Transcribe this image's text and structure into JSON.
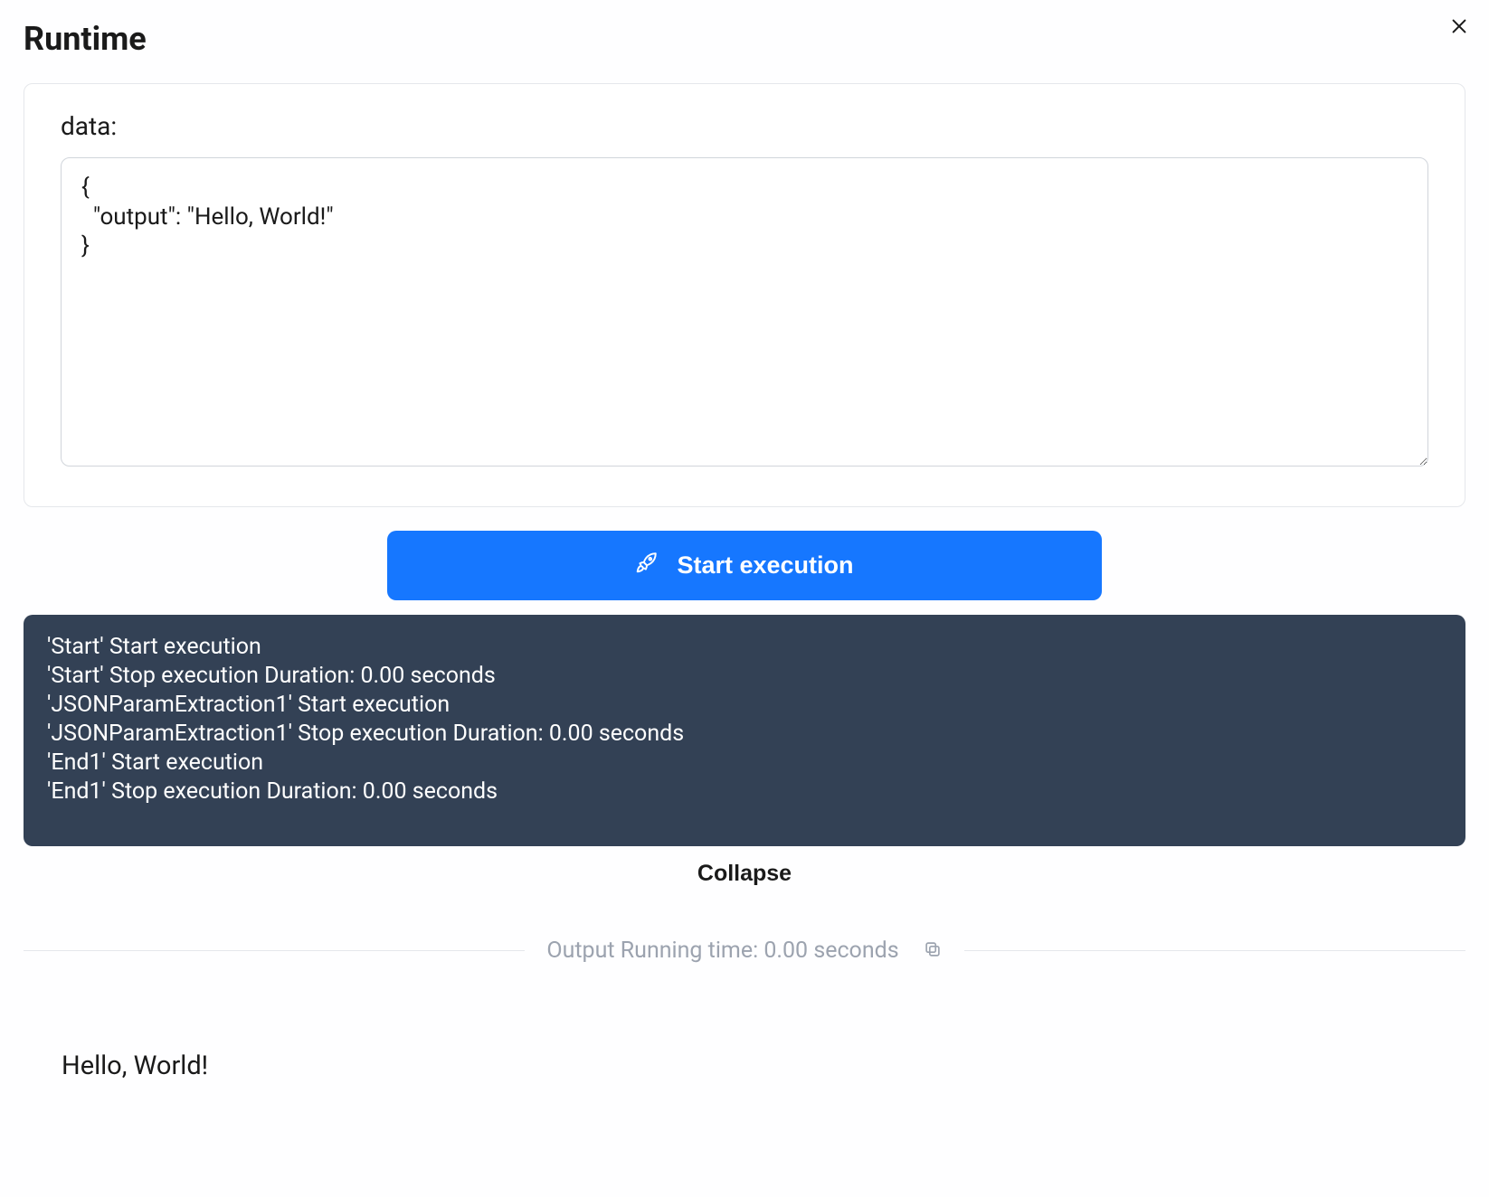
{
  "header": {
    "title": "Runtime"
  },
  "input": {
    "label": "data:",
    "value": "{\n  \"output\": \"Hello, World!\"\n}"
  },
  "actions": {
    "start_label": "Start execution",
    "collapse_label": "Collapse"
  },
  "log": {
    "lines": [
      "'Start' Start execution",
      "'Start' Stop execution Duration: 0.00 seconds",
      "'JSONParamExtraction1' Start execution",
      "'JSONParamExtraction1' Stop execution Duration: 0.00 seconds",
      "'End1' Start execution",
      "'End1' Stop execution Duration: 0.00 seconds"
    ]
  },
  "divider": {
    "label": "Output Running time: 0.00 seconds"
  },
  "output": {
    "text": "Hello, World!"
  }
}
